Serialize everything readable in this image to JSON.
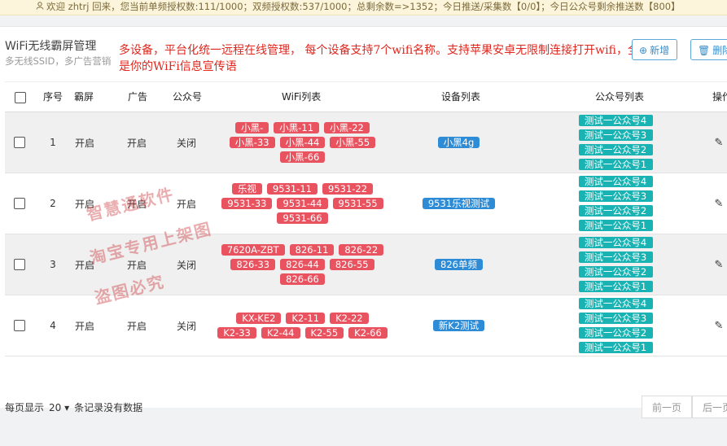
{
  "notice": "欢迎 zhtrj 回来，您当前单频授权数:111/1000；双频授权数:537/1000；总剩余数=>1352；今日推送/采集数【0/0】；今日公众号剩余推送数【800】",
  "page": {
    "title": "WiFi无线霸屏管理",
    "subtitle": "多无线SSID，多广告营销",
    "red_note": "多设备，平台化统一远程在线管理， 每个设备支持7个wifi名称。支持苹果安卓无限制连接打开wifi，全部是你的WiFi信息宣传语",
    "add_button": "新增",
    "delete_button": "删除"
  },
  "table": {
    "headers": [
      "序号",
      "霸屏",
      "广告",
      "公众号",
      "WiFi列表",
      "设备列表",
      "公众号列表",
      "操作"
    ],
    "rows": [
      {
        "no": "1",
        "bapin": "开启",
        "ad": "开启",
        "gzh": "关闭",
        "wifi": [
          "小黑-",
          "小黑-11",
          "小黑-22",
          "小黑-33",
          "小黑-44",
          "小黑-55",
          "小黑-66"
        ],
        "device": "小黑4g",
        "accounts": [
          "测试一公众号4",
          "测试一公众号3",
          "测试一公众号2",
          "测试一公众号1"
        ]
      },
      {
        "no": "2",
        "bapin": "开启",
        "ad": "开启",
        "gzh": "开启",
        "wifi": [
          "乐视",
          "9531-11",
          "9531-22",
          "9531-33",
          "9531-44",
          "9531-55",
          "9531-66"
        ],
        "device": "9531乐视测试",
        "accounts": [
          "测试一公众号4",
          "测试一公众号3",
          "测试一公众号2",
          "测试一公众号1"
        ]
      },
      {
        "no": "3",
        "bapin": "开启",
        "ad": "开启",
        "gzh": "关闭",
        "wifi": [
          "7620A-ZBT",
          "826-11",
          "826-22",
          "826-33",
          "826-44",
          "826-55",
          "826-66"
        ],
        "device": "826单频",
        "accounts": [
          "测试一公众号4",
          "测试一公众号3",
          "测试一公众号2",
          "测试一公众号1"
        ]
      },
      {
        "no": "4",
        "bapin": "开启",
        "ad": "开启",
        "gzh": "关闭",
        "wifi": [
          "KX-KE2",
          "K2-11",
          "K2-22",
          "K2-33",
          "K2-44",
          "K2-55",
          "K2-66"
        ],
        "device": "新K2测试",
        "accounts": [
          "测试一公众号4",
          "测试一公众号3",
          "测试一公众号2",
          "测试一公众号1"
        ]
      }
    ]
  },
  "footer": {
    "per_page_label": "每页显示",
    "page_size": "20",
    "no_data": "条记录没有数据",
    "prev": "前一页",
    "next": "后一页"
  },
  "watermarks": [
    "智慧通软件",
    "淘宝专用上架图",
    "盗图必究"
  ],
  "icons": {
    "user": "user-icon",
    "add": "plus-circle-icon",
    "delete": "trash-icon",
    "edit": "pencil-icon",
    "dropdown": "caret-down-icon"
  },
  "colors": {
    "wifi_tag": "#e8535f",
    "device_tag": "#2e8bd6",
    "account_tag": "#19b3b3",
    "red_note": "#e0261d"
  }
}
